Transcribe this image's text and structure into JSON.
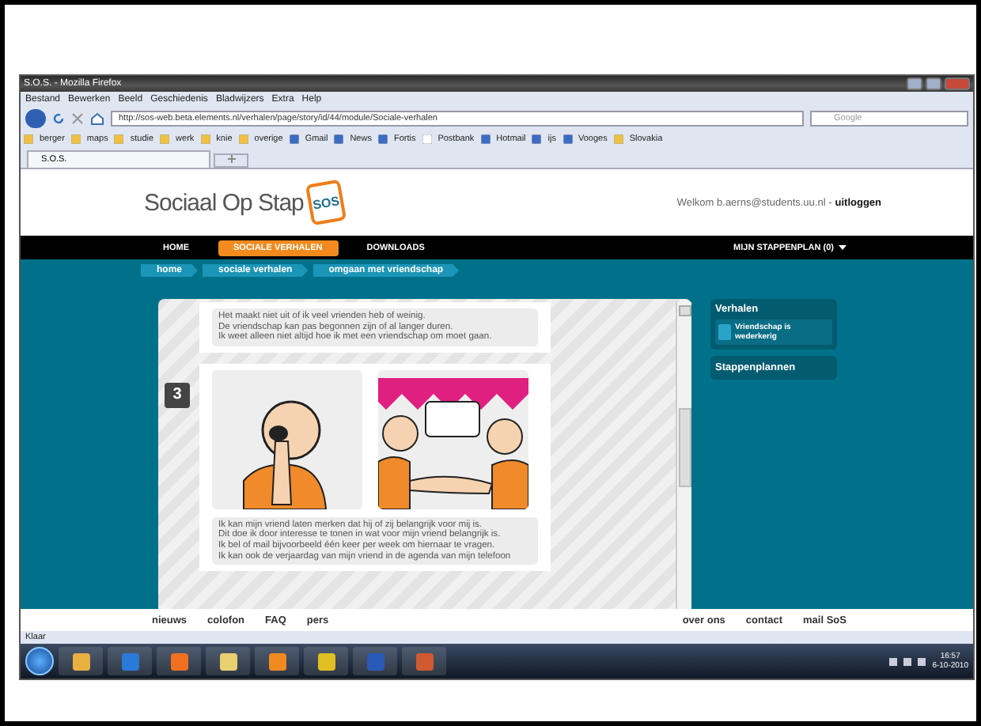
{
  "window": {
    "title": "S.O.S. - Mozilla Firefox"
  },
  "menu": [
    "Bestand",
    "Bewerken",
    "Beeld",
    "Geschiedenis",
    "Bladwijzers",
    "Extra",
    "Help"
  ],
  "address": {
    "value": "http://sos-web.beta.elements.nl/verhalen/page/story/id/44/module/Sociale-verhalen"
  },
  "search": {
    "placeholder": "Google"
  },
  "bookmarks": [
    {
      "label": "berger",
      "kind": "folder"
    },
    {
      "label": "maps",
      "kind": "folder"
    },
    {
      "label": "studie",
      "kind": "folder"
    },
    {
      "label": "werk",
      "kind": "folder"
    },
    {
      "label": "knie",
      "kind": "folder"
    },
    {
      "label": "overige",
      "kind": "folder"
    },
    {
      "label": "Gmail",
      "kind": "site"
    },
    {
      "label": "News",
      "kind": "site"
    },
    {
      "label": "Fortis",
      "kind": "site"
    },
    {
      "label": "Postbank",
      "kind": "page"
    },
    {
      "label": "Hotmail",
      "kind": "site"
    },
    {
      "label": "ijs",
      "kind": "site"
    },
    {
      "label": "Vooges",
      "kind": "site"
    },
    {
      "label": "Slovakia",
      "kind": "folder"
    }
  ],
  "tab": {
    "title": "S.O.S."
  },
  "site": {
    "logo": "Sociaal Op Stap",
    "badge": "SOS",
    "welcome": "Welkom b.aerns@students.uu.nl -",
    "logout": "uitloggen"
  },
  "nav": [
    {
      "label": "HOME",
      "selected": false
    },
    {
      "label": "SOCIALE VERHALEN",
      "selected": true
    },
    {
      "label": "DOWNLOADS",
      "selected": false
    }
  ],
  "nav_right": "MIJN STAPPENPLAN (0)",
  "breadcrumbs": [
    "home",
    "sociale verhalen",
    "omgaan met vriendschap"
  ],
  "story": [
    {
      "lines": [
        "Het maakt niet uit of ik veel vrienden heb of weinig.",
        "De vriendschap kan pas begonnen zijn of al langer duren.",
        "Ik weet alleen niet altijd hoe ik met een vriendschap om moet gaan."
      ]
    },
    {
      "step": "3",
      "lines": [
        "Ik kan mijn vriend laten merken dat hij of zij belangrijk voor mij is.",
        "Dit doe ik door interesse te tonen in wat voor mijn vriend belangrijk is.",
        "Ik bel of mail bijvoorbeeld één keer per week om hiernaar te vragen.",
        "Ik kan ook de verjaardag van mijn vriend in de agenda van mijn telefoon"
      ]
    }
  ],
  "sidebar": {
    "heading": "Verhalen",
    "item": "Vriendschap is wederkerig",
    "section": "Stappenplannen"
  },
  "footer": {
    "left": [
      "nieuws",
      "colofon",
      "FAQ",
      "pers"
    ],
    "right": [
      "over ons",
      "contact",
      "mail SoS"
    ]
  },
  "status_bar": "Klaar",
  "clock": {
    "time": "16:57",
    "date": "6-10-2010"
  }
}
